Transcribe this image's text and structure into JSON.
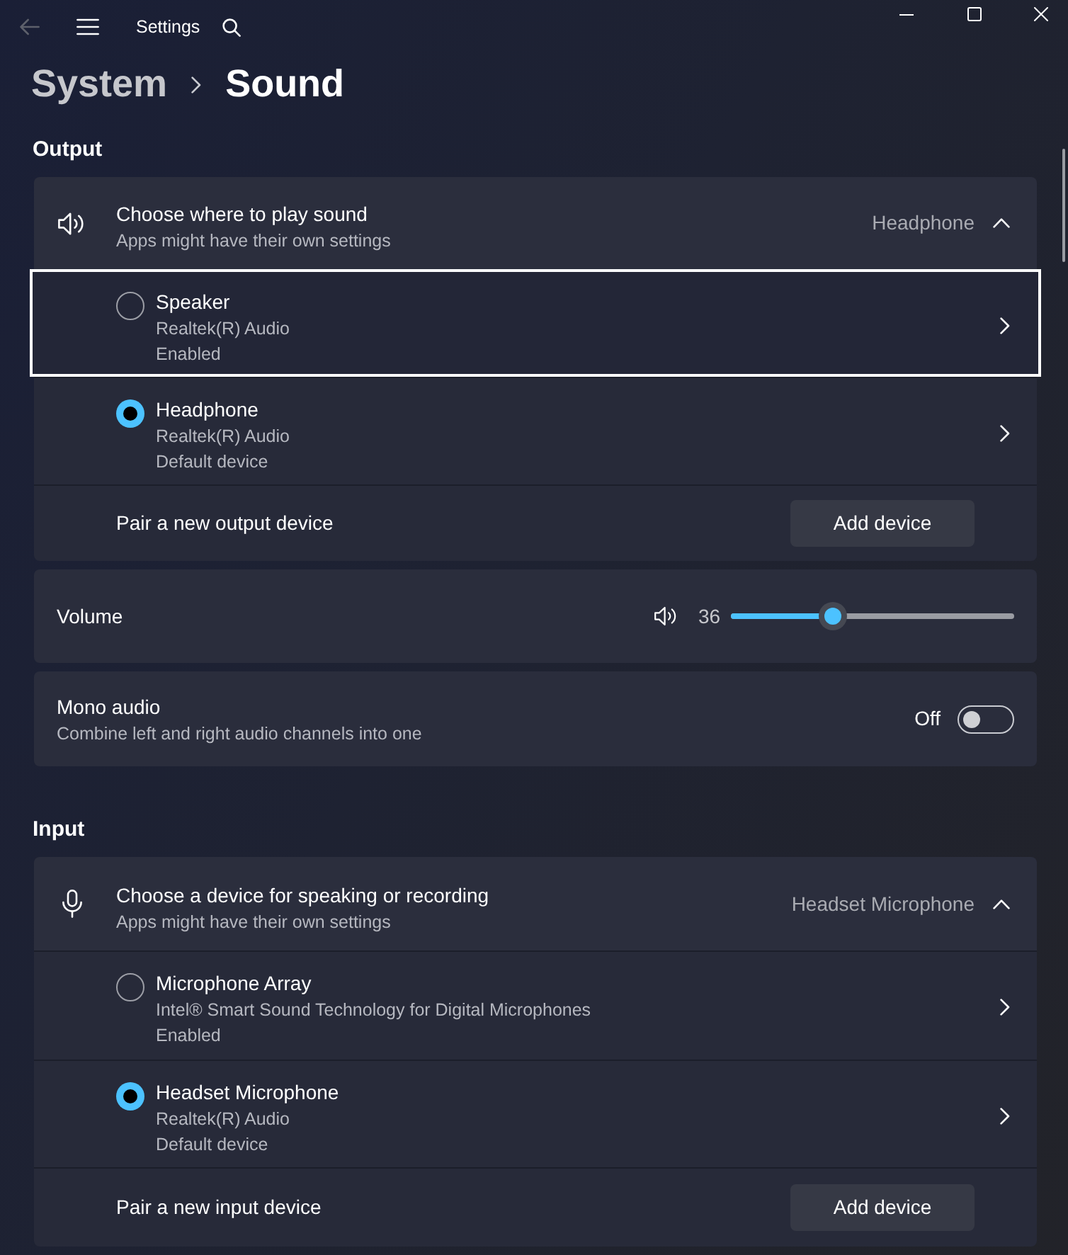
{
  "window": {
    "title": "Settings"
  },
  "breadcrumb": [
    {
      "label": "System"
    },
    {
      "label": "Sound"
    }
  ],
  "output": {
    "heading": "Output",
    "picker": {
      "title": "Choose where to play sound",
      "subtitle": "Apps might have their own settings",
      "value": "Headphone",
      "expanded": true,
      "devices": [
        {
          "name": "Speaker",
          "details": [
            "Realtek(R) Audio",
            "Enabled"
          ],
          "selected": false,
          "focused": true
        },
        {
          "name": "Headphone",
          "details": [
            "Realtek(R) Audio",
            "Default device"
          ],
          "selected": true,
          "focused": false
        }
      ],
      "pair": {
        "label": "Pair a new output device",
        "button": "Add device"
      }
    },
    "volume": {
      "label": "Volume",
      "reading": "36",
      "level": 0.36
    },
    "mono_audio": {
      "title": "Mono audio",
      "subtitle": "Combine left and right audio channels into one",
      "state_label": "Off",
      "on": false
    }
  },
  "input": {
    "heading": "Input",
    "picker": {
      "title": "Choose a device for speaking or recording",
      "subtitle": "Apps might have their own settings",
      "value": "Headset Microphone",
      "expanded": true,
      "devices": [
        {
          "name": "Microphone Array",
          "details": [
            "Intel® Smart Sound Technology for Digital Microphones",
            "Enabled"
          ],
          "selected": false,
          "focused": false
        },
        {
          "name": "Headset Microphone",
          "details": [
            "Realtek(R) Audio",
            "Default device"
          ],
          "selected": true,
          "focused": false
        }
      ],
      "pair": {
        "label": "Pair a new input device",
        "button": "Add device"
      }
    }
  }
}
